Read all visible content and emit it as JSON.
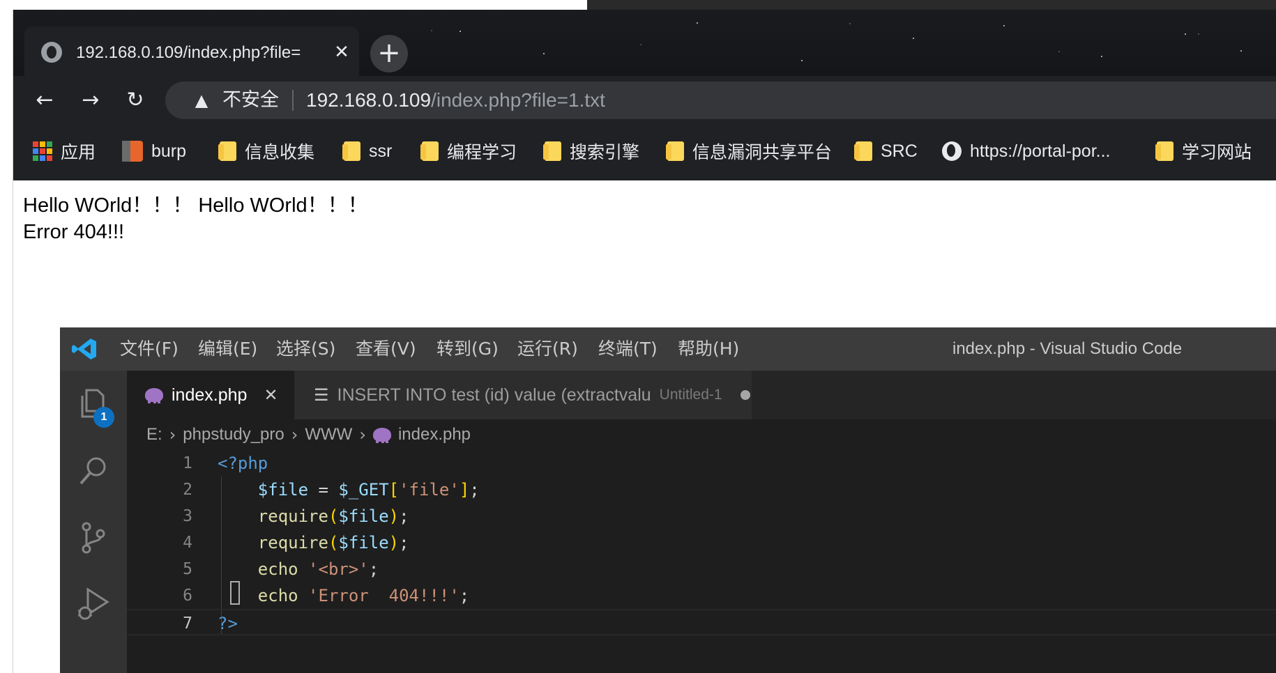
{
  "browser": {
    "tab": {
      "title": "192.168.0.109/index.php?file="
    },
    "address": {
      "security_label": "不安全",
      "host": "192.168.0.109",
      "path": "/index.php?file=1.txt"
    },
    "bookmarks": [
      {
        "label": "应用",
        "icon": "apps-grid-icon"
      },
      {
        "label": "burp",
        "icon": "burp-icon"
      },
      {
        "label": "信息收集",
        "icon": "folder-icon"
      },
      {
        "label": "ssr",
        "icon": "folder-icon"
      },
      {
        "label": "编程学习",
        "icon": "folder-icon"
      },
      {
        "label": "搜索引擎",
        "icon": "folder-icon"
      },
      {
        "label": "信息漏洞共享平台",
        "icon": "folder-icon"
      },
      {
        "label": "SRC",
        "icon": "folder-icon"
      },
      {
        "label": "https://portal-por...",
        "icon": "globe-icon"
      },
      {
        "label": "学习网站",
        "icon": "folder-icon"
      }
    ],
    "page": {
      "line1": "Hello WOrld！！！ Hello WOrld！！！",
      "line2": "Error 404!!!"
    }
  },
  "vscode": {
    "menu": [
      "文件(F)",
      "编辑(E)",
      "选择(S)",
      "查看(V)",
      "转到(G)",
      "运行(R)",
      "终端(T)",
      "帮助(H)"
    ],
    "window_title": "index.php - Visual Studio Code",
    "explorer_badge": "1",
    "tabs": [
      {
        "label": "index.php",
        "active": true
      },
      {
        "label": "INSERT INTO test (id) value (extractvalu",
        "description": "Untitled-1",
        "dirty": true
      }
    ],
    "breadcrumbs": [
      "E:",
      "phpstudy_pro",
      "WWW",
      "index.php"
    ],
    "code_lines": [
      {
        "n": "1",
        "text": "<?php"
      },
      {
        "n": "2",
        "text": "    $file = $_GET['file'];"
      },
      {
        "n": "3",
        "text": "    require($file);"
      },
      {
        "n": "4",
        "text": "    require($file);"
      },
      {
        "n": "5",
        "text": "    echo '<br>';"
      },
      {
        "n": "6",
        "text": "    echo 'Error  404!!!';"
      },
      {
        "n": "7",
        "text": "?>"
      }
    ],
    "colors": {
      "keyword": "#569cd6",
      "variable": "#9cdcfe",
      "string": "#ce9178",
      "function": "#dcdcaa",
      "bracket": "#ffd700",
      "php_icon": "#a074c4"
    }
  }
}
